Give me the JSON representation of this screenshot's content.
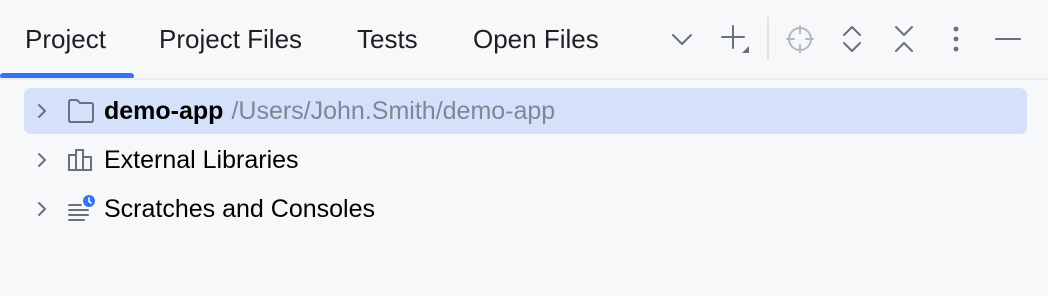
{
  "tabs": [
    {
      "label": "Project",
      "active": true
    },
    {
      "label": "Project Files",
      "active": false
    },
    {
      "label": "Tests",
      "active": false
    },
    {
      "label": "Open Files",
      "active": false
    }
  ],
  "toolbar": {
    "icons": [
      "chevron-down-icon",
      "add-icon",
      "locate-icon",
      "expand-all-icon",
      "collapse-all-icon",
      "more-options-icon",
      "minimize-icon"
    ]
  },
  "tree": [
    {
      "label": "demo-app",
      "path": "/Users/John.Smith/demo-app",
      "icon": "folder-icon",
      "selected": true
    },
    {
      "label": "External Libraries",
      "icon": "library-icon",
      "selected": false
    },
    {
      "label": "Scratches and Consoles",
      "icon": "scratches-icon",
      "selected": false
    }
  ],
  "colors": {
    "accent": "#3574f0",
    "selection": "#d5e1fb",
    "background": "#f7f8fa",
    "path_text": "#818594"
  }
}
